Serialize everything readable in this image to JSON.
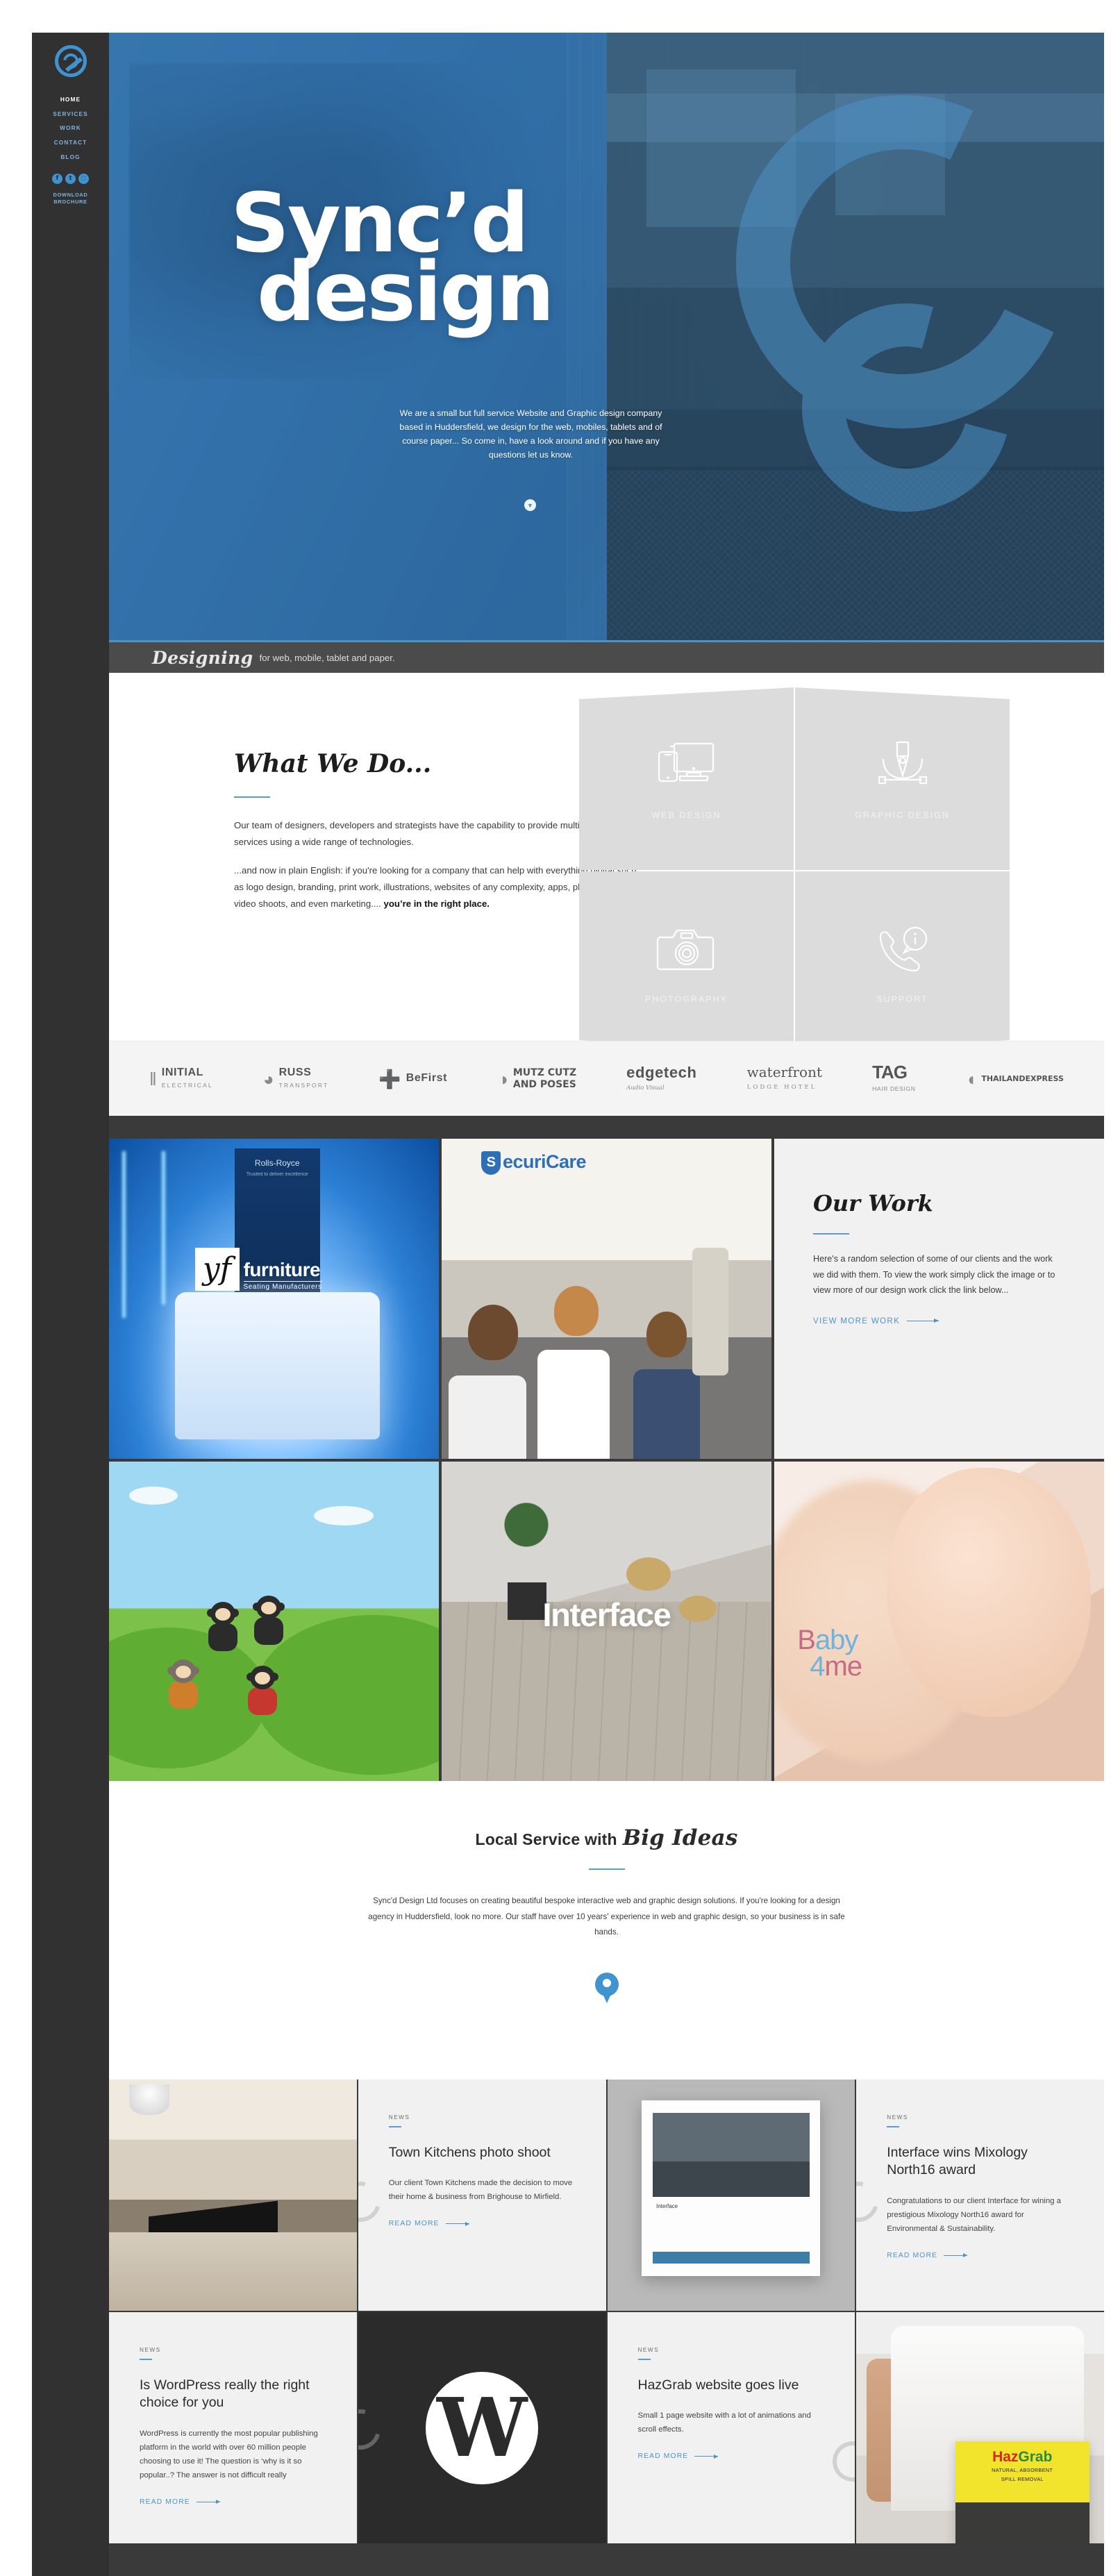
{
  "brand": {
    "name": "Sync'd Design",
    "accent": "#3f93d1",
    "dark": "#313131"
  },
  "sidebar": {
    "logo_icon": "sync-refresh-logo",
    "nav": [
      {
        "label": "HOME",
        "active": true
      },
      {
        "label": "SERVICES",
        "active": false
      },
      {
        "label": "WORK",
        "active": false
      },
      {
        "label": "CONTACT",
        "active": false
      },
      {
        "label": "BLOG",
        "active": false
      }
    ],
    "socials": [
      {
        "name": "facebook-icon",
        "glyph": "f"
      },
      {
        "name": "twitter-icon",
        "glyph": "t"
      },
      {
        "name": "dribbble-icon",
        "glyph": "◌"
      }
    ],
    "brochure_line1": "DOWNLOAD",
    "brochure_line2": "BROCHURE"
  },
  "hero": {
    "title_line1": "Sync’d",
    "title_line2": "design",
    "paragraph": "We are a small but full service Website and Graphic design company based in Huddersfield, we design for the web, mobiles, tablets and of course paper... So come in, have a look around and if you have any questions let us know.",
    "scroll_glyph": "▼"
  },
  "designing_bar": {
    "script": "Designing",
    "rest": "for web, mobile, tablet and paper."
  },
  "what_we_do": {
    "heading": "What We Do...",
    "p1": "Our team of designers, developers and strategists have the capability to provide multi-disciplined services using a wide range of technologies.",
    "p2_lead": "...and now in plain English: if you're looking for a company that can help with everything digital such as logo design, branding, print work, illustrations, websites of any complexity, apps, photography, video shoots, and even marketing....",
    "p2_bold": "you’re in the right place."
  },
  "services": [
    {
      "label": "WEB DESIGN",
      "icon": "devices-icon"
    },
    {
      "label": "GRAPHIC DESIGN",
      "icon": "pen-nib-icon"
    },
    {
      "label": "PHOTOGRAPHY",
      "icon": "camera-icon"
    },
    {
      "label": "SUPPORT",
      "icon": "phone-info-icon"
    }
  ],
  "client_logos": [
    {
      "mark": "‖",
      "t1": "INITIAL",
      "t2": "ELECTRICAL",
      "style": "default"
    },
    {
      "mark": "◕",
      "t1": "RUSS",
      "t2": "TRANSPORT",
      "style": "default"
    },
    {
      "mark": "➕",
      "t1": "BeFirst",
      "t2": "",
      "style": "plus"
    },
    {
      "mark": "◑",
      "t1": "MUTZ CUTZ",
      "t2": "AND POSES",
      "style": "cond"
    },
    {
      "mark": "",
      "t1": "edgetech",
      "t2": "Audio Visual",
      "style": "edge"
    },
    {
      "mark": "",
      "t1": "waterfront",
      "t2": "LODGE HOTEL",
      "style": "serif"
    },
    {
      "mark": "",
      "t1": "TAG",
      "t2": "HAIR DESIGN",
      "style": "tag"
    },
    {
      "mark": "◖",
      "t1": "THAILANDEXPRESS",
      "t2": "",
      "style": "cond"
    }
  ],
  "our_work": {
    "heading": "Our Work",
    "paragraph": "Here's a random selection of some of our clients and the work we did with them. To view the work simply click the image or to view more of our design work click the link below...",
    "link": "VIEW MORE WORK"
  },
  "work_tiles": [
    {
      "name": "yf-furniture",
      "logo_box": "yf",
      "word1": "furniture",
      "word2": "Seating Manufacturers",
      "banner": "Rolls-Royce",
      "banner_sub": "Trusted to deliver excellence"
    },
    {
      "name": "securicare",
      "logo_text": "ecuriCare"
    },
    {
      "name": "our-work-panel"
    },
    {
      "name": "monkeys-illustration"
    },
    {
      "name": "interface",
      "caption": "Interface"
    },
    {
      "name": "baby4me",
      "l1a": "B",
      "l1b": "aby",
      "l2a": "4",
      "l2b": "me"
    }
  ],
  "local_service": {
    "heading_plain": "Local Service with",
    "heading_script": "Big Ideas",
    "paragraph": "Sync'd Design Ltd focuses on creating beautiful bespoke interactive web and graphic design solutions. If you're looking for a design agency in Huddersfield, look no more. Our staff have over 10 years' experience in web and graphic design, so your business is in safe hands.",
    "map_pin_icon": "map-pin-icon"
  },
  "news": {
    "kicker": "NEWS",
    "read_more": "READ MORE",
    "items": [
      {
        "title": "Town Kitchens photo shoot",
        "excerpt": "Our client Town Kitchens made the decision to move their home & business from Brighouse to Mirfield."
      },
      {
        "title": "Interface wins Mixology North16 award",
        "excerpt": "Congratulations to our client Interface for wining a prestigious Mixology North16 award for Environmental & Sustainability."
      },
      {
        "title": "Is WordPress really the right choice for you",
        "excerpt": "WordPress is currently the most popular publishing platform in the world with over 60 million people choosing to use it! The question is ‘why is it so popular..? The answer is not difficult really"
      },
      {
        "title": "HazGrab website goes live",
        "excerpt": "Small 1 page website with a lot of animations and scroll effects."
      }
    ],
    "wp_glyph": "W",
    "haz_title_a": "Haz",
    "haz_title_b": "Grab",
    "haz_sub1": "NATURAL, ABSORBENT",
    "haz_sub2": "SPILL REMOVAL",
    "mixology_caption": "Interface"
  }
}
